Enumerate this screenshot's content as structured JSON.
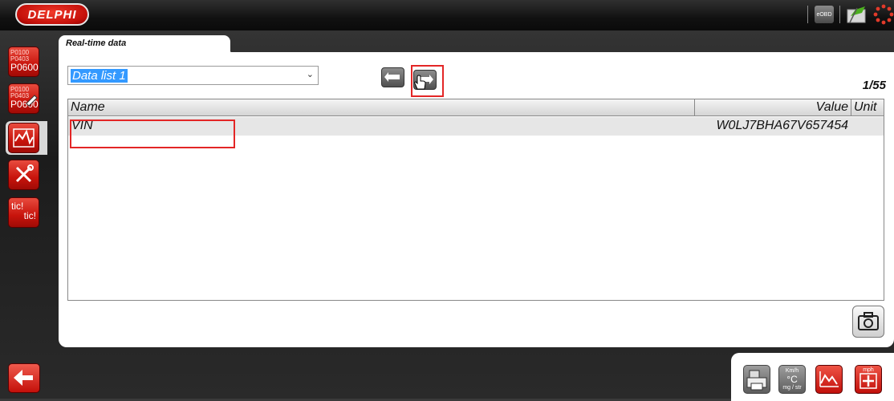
{
  "header": {
    "brand": "DELPHI",
    "eobd_label": "eOBD"
  },
  "sidebar": {
    "fault_codes": [
      "P0100",
      "P0403",
      "P0600"
    ],
    "tic_label_1": "tic!",
    "tic_label_2": "tic!"
  },
  "tab": {
    "label": "Real-time data"
  },
  "data_list": {
    "selected": "Data list 1"
  },
  "page_indicator": "1/55",
  "table": {
    "columns": [
      "Name",
      "Value",
      "Unit"
    ],
    "rows": [
      {
        "name": "VIN",
        "value": "W0LJ7BHA67V657454",
        "unit": ""
      }
    ]
  },
  "bottom_icons": {
    "units_top": "Km/h",
    "units_mid": "°C",
    "units_bot": "mg / str",
    "mph_label": "mph"
  },
  "colors": {
    "accent_red": "#c8140c",
    "highlight_outline": "#e32626",
    "selection_blue": "#3399ff"
  }
}
